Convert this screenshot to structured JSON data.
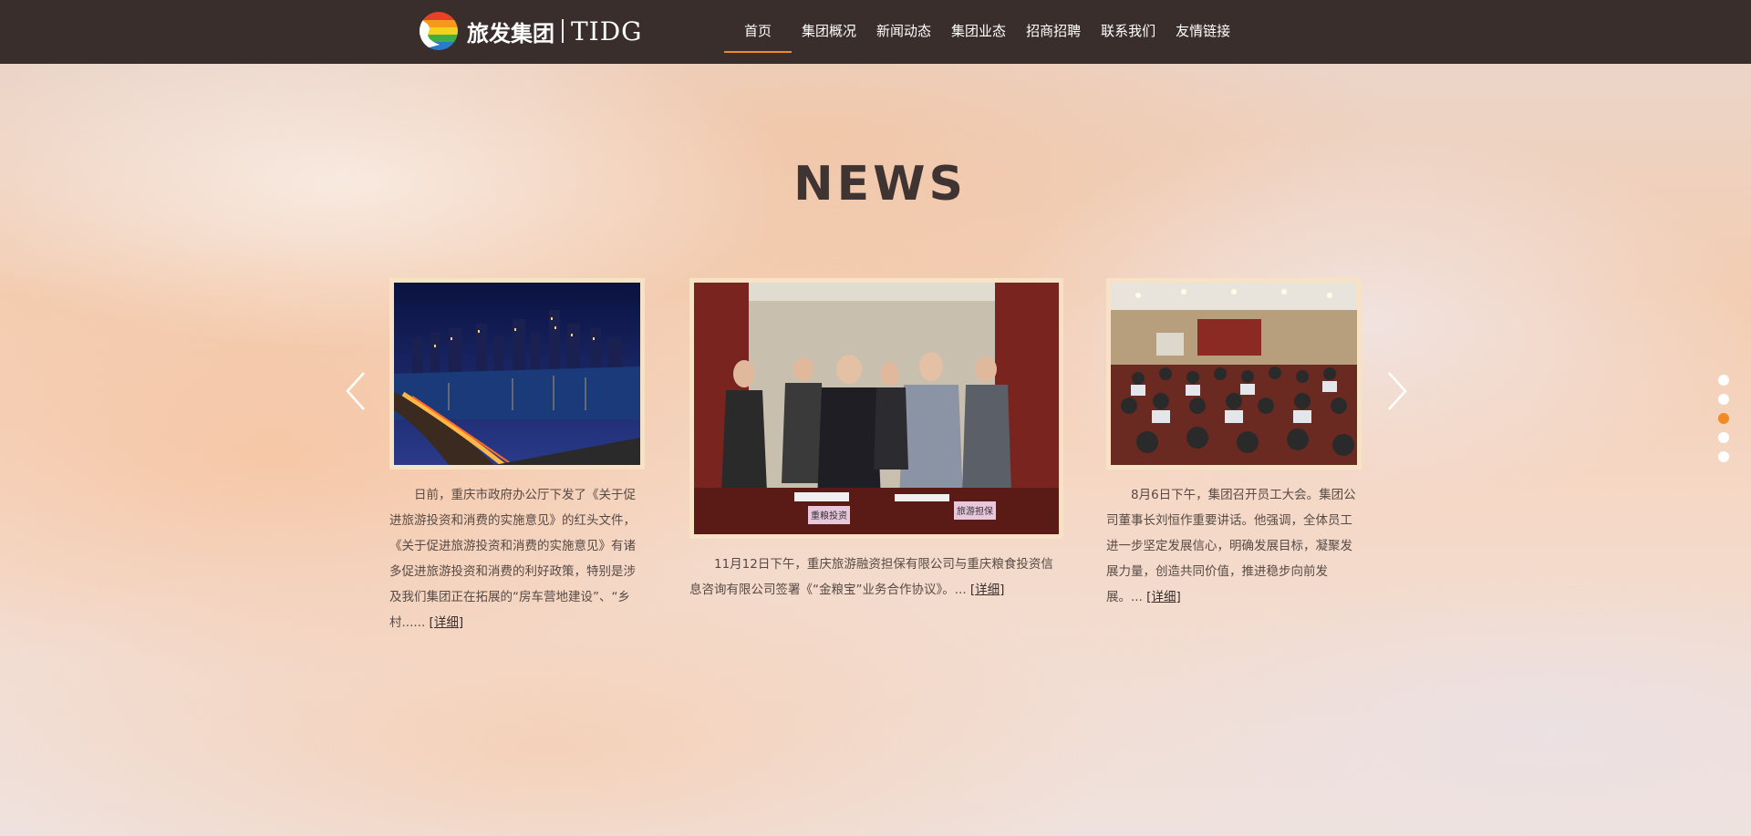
{
  "header": {
    "logo_cn": "旅发集团",
    "logo_en": "TIDG",
    "accent_color": "#f08a24",
    "bg_color": "#3a2e2d"
  },
  "nav": {
    "items": [
      {
        "label": "首页",
        "active": true
      },
      {
        "label": "集团概况"
      },
      {
        "label": "新闻动态"
      },
      {
        "label": "集团业态"
      },
      {
        "label": "招商招聘"
      },
      {
        "label": "联系我们"
      },
      {
        "label": "友情链接"
      }
    ]
  },
  "news": {
    "title": "NEWS",
    "prev_icon": "chevron-left-icon",
    "next_icon": "chevron-right-icon",
    "cards": [
      {
        "image": "city-night-river-photo",
        "text": "日前，重庆市政府办公厅下发了《关于促进旅游投资和消费的实施意见》的红头文件，《关于促进旅游投资和消费的实施意见》有诸多促进旅游投资和消费的利好政策，特别是涉及我们集团正在拓展的“房车营地建设”、“乡村...... ",
        "more": "[详细]"
      },
      {
        "image": "signing-handshake-photo",
        "text": "11月12日下午，重庆旅游融资担保有限公司与重庆粮食投资信息咨询有限公司签署《“金粮宝”业务合作协议》。... ",
        "more": "[详细]",
        "sign_left": "重粮投资",
        "sign_right": "旅游担保"
      },
      {
        "image": "staff-meeting-hall-photo",
        "text": "8月6日下午，集团召开员工大会。集团公司董事长刘恒作重要讲话。他强调，全体员工进一步坚定发展信心，明确发展目标，凝聚发展力量，创造共同价值，推进稳步向前发展。... ",
        "more": "[详细]"
      }
    ]
  },
  "pagination": {
    "count": 5,
    "active_index": 2
  }
}
